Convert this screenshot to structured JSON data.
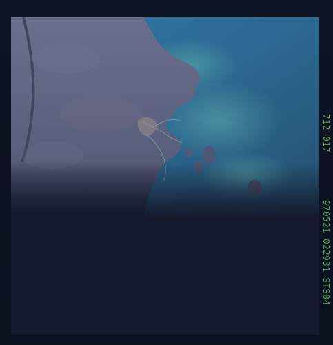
{
  "photo": {
    "label_top": "712 017",
    "label_bottom": "970521 022931 STS84"
  },
  "colors": {
    "film_border": "#0e1322",
    "land": "#5c6384",
    "ocean": "#2f6a8c",
    "shallow_water": "#3f8fa0",
    "label_green": "#3fae4a"
  }
}
